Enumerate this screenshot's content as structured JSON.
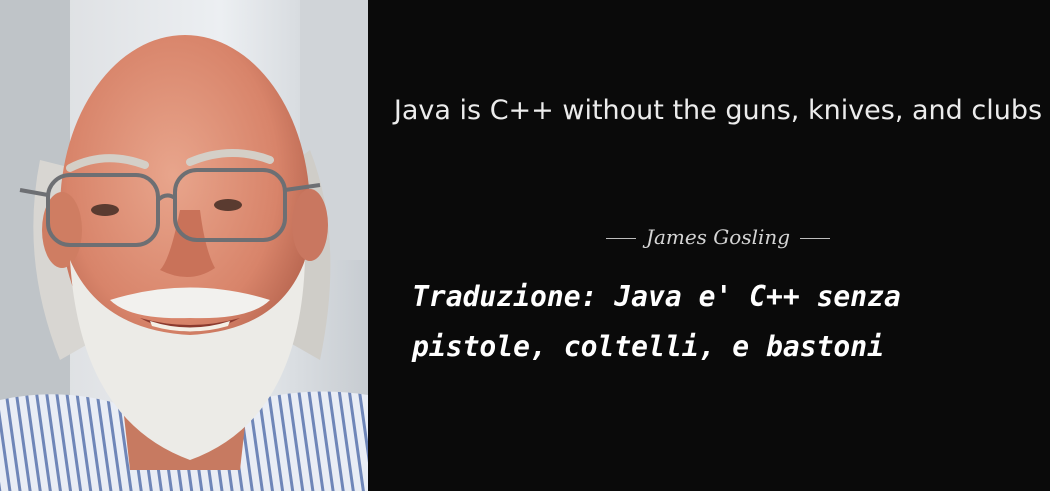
{
  "quote": {
    "text": "Java is C++ without the guns, knives, and clubs",
    "author": "James Gosling"
  },
  "translation": {
    "text": "Traduzione: Java e' C++ senza\npistole, coltelli, e bastoni"
  },
  "colors": {
    "background": "#0a0a0a",
    "quote_text": "#ececec",
    "translation_text": "#ffffff"
  }
}
